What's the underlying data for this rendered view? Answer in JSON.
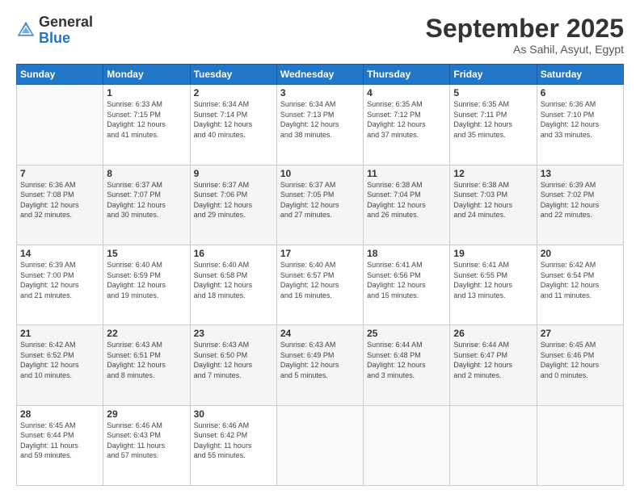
{
  "header": {
    "logo_general": "General",
    "logo_blue": "Blue",
    "month_title": "September 2025",
    "location": "As Sahil, Asyut, Egypt"
  },
  "days_of_week": [
    "Sunday",
    "Monday",
    "Tuesday",
    "Wednesday",
    "Thursday",
    "Friday",
    "Saturday"
  ],
  "weeks": [
    [
      {
        "day": "",
        "info": ""
      },
      {
        "day": "1",
        "info": "Sunrise: 6:33 AM\nSunset: 7:15 PM\nDaylight: 12 hours\nand 41 minutes."
      },
      {
        "day": "2",
        "info": "Sunrise: 6:34 AM\nSunset: 7:14 PM\nDaylight: 12 hours\nand 40 minutes."
      },
      {
        "day": "3",
        "info": "Sunrise: 6:34 AM\nSunset: 7:13 PM\nDaylight: 12 hours\nand 38 minutes."
      },
      {
        "day": "4",
        "info": "Sunrise: 6:35 AM\nSunset: 7:12 PM\nDaylight: 12 hours\nand 37 minutes."
      },
      {
        "day": "5",
        "info": "Sunrise: 6:35 AM\nSunset: 7:11 PM\nDaylight: 12 hours\nand 35 minutes."
      },
      {
        "day": "6",
        "info": "Sunrise: 6:36 AM\nSunset: 7:10 PM\nDaylight: 12 hours\nand 33 minutes."
      }
    ],
    [
      {
        "day": "7",
        "info": "Sunrise: 6:36 AM\nSunset: 7:08 PM\nDaylight: 12 hours\nand 32 minutes."
      },
      {
        "day": "8",
        "info": "Sunrise: 6:37 AM\nSunset: 7:07 PM\nDaylight: 12 hours\nand 30 minutes."
      },
      {
        "day": "9",
        "info": "Sunrise: 6:37 AM\nSunset: 7:06 PM\nDaylight: 12 hours\nand 29 minutes."
      },
      {
        "day": "10",
        "info": "Sunrise: 6:37 AM\nSunset: 7:05 PM\nDaylight: 12 hours\nand 27 minutes."
      },
      {
        "day": "11",
        "info": "Sunrise: 6:38 AM\nSunset: 7:04 PM\nDaylight: 12 hours\nand 26 minutes."
      },
      {
        "day": "12",
        "info": "Sunrise: 6:38 AM\nSunset: 7:03 PM\nDaylight: 12 hours\nand 24 minutes."
      },
      {
        "day": "13",
        "info": "Sunrise: 6:39 AM\nSunset: 7:02 PM\nDaylight: 12 hours\nand 22 minutes."
      }
    ],
    [
      {
        "day": "14",
        "info": "Sunrise: 6:39 AM\nSunset: 7:00 PM\nDaylight: 12 hours\nand 21 minutes."
      },
      {
        "day": "15",
        "info": "Sunrise: 6:40 AM\nSunset: 6:59 PM\nDaylight: 12 hours\nand 19 minutes."
      },
      {
        "day": "16",
        "info": "Sunrise: 6:40 AM\nSunset: 6:58 PM\nDaylight: 12 hours\nand 18 minutes."
      },
      {
        "day": "17",
        "info": "Sunrise: 6:40 AM\nSunset: 6:57 PM\nDaylight: 12 hours\nand 16 minutes."
      },
      {
        "day": "18",
        "info": "Sunrise: 6:41 AM\nSunset: 6:56 PM\nDaylight: 12 hours\nand 15 minutes."
      },
      {
        "day": "19",
        "info": "Sunrise: 6:41 AM\nSunset: 6:55 PM\nDaylight: 12 hours\nand 13 minutes."
      },
      {
        "day": "20",
        "info": "Sunrise: 6:42 AM\nSunset: 6:54 PM\nDaylight: 12 hours\nand 11 minutes."
      }
    ],
    [
      {
        "day": "21",
        "info": "Sunrise: 6:42 AM\nSunset: 6:52 PM\nDaylight: 12 hours\nand 10 minutes."
      },
      {
        "day": "22",
        "info": "Sunrise: 6:43 AM\nSunset: 6:51 PM\nDaylight: 12 hours\nand 8 minutes."
      },
      {
        "day": "23",
        "info": "Sunrise: 6:43 AM\nSunset: 6:50 PM\nDaylight: 12 hours\nand 7 minutes."
      },
      {
        "day": "24",
        "info": "Sunrise: 6:43 AM\nSunset: 6:49 PM\nDaylight: 12 hours\nand 5 minutes."
      },
      {
        "day": "25",
        "info": "Sunrise: 6:44 AM\nSunset: 6:48 PM\nDaylight: 12 hours\nand 3 minutes."
      },
      {
        "day": "26",
        "info": "Sunrise: 6:44 AM\nSunset: 6:47 PM\nDaylight: 12 hours\nand 2 minutes."
      },
      {
        "day": "27",
        "info": "Sunrise: 6:45 AM\nSunset: 6:46 PM\nDaylight: 12 hours\nand 0 minutes."
      }
    ],
    [
      {
        "day": "28",
        "info": "Sunrise: 6:45 AM\nSunset: 6:44 PM\nDaylight: 11 hours\nand 59 minutes."
      },
      {
        "day": "29",
        "info": "Sunrise: 6:46 AM\nSunset: 6:43 PM\nDaylight: 11 hours\nand 57 minutes."
      },
      {
        "day": "30",
        "info": "Sunrise: 6:46 AM\nSunset: 6:42 PM\nDaylight: 11 hours\nand 55 minutes."
      },
      {
        "day": "",
        "info": ""
      },
      {
        "day": "",
        "info": ""
      },
      {
        "day": "",
        "info": ""
      },
      {
        "day": "",
        "info": ""
      }
    ]
  ]
}
